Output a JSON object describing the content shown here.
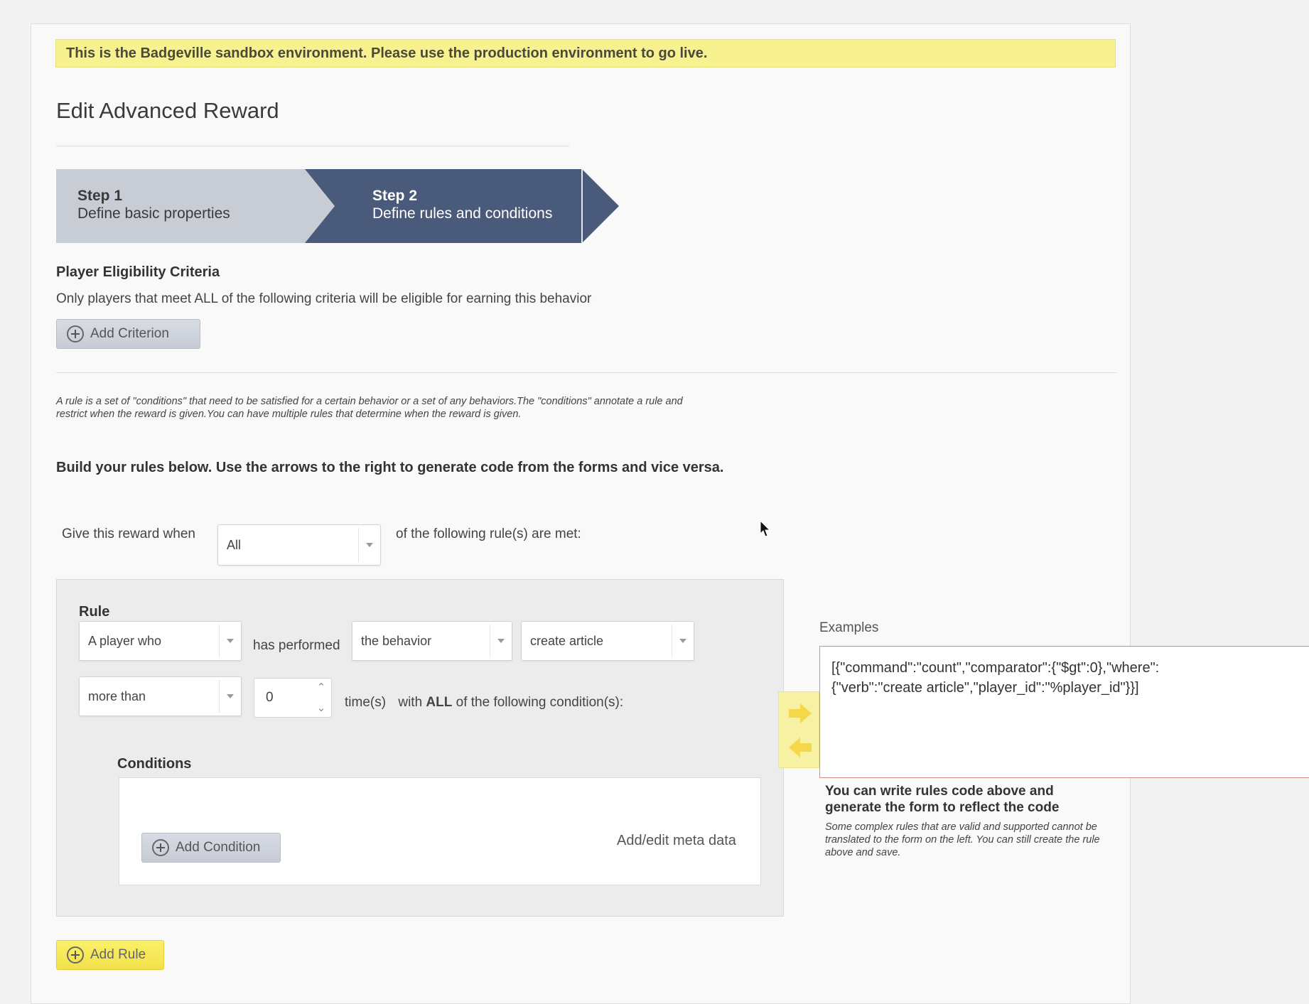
{
  "banner": "This is the Badgeville sandbox environment. Please use the production environment to go live.",
  "page_title": "Edit Advanced Reward",
  "wizard": {
    "steps": [
      {
        "number": "Step 1",
        "label": "Define basic properties"
      },
      {
        "number": "Step 2",
        "label": "Define rules and conditions"
      }
    ],
    "active_index": 1
  },
  "eligibility": {
    "heading": "Player Eligibility Criteria",
    "description": "Only players that meet ALL of the following criteria will be eligible for earning this behavior",
    "add_button": "Add Criterion"
  },
  "rules_intro": {
    "description": "A rule is a set of \"conditions\" that need to be satisfied for a certain behavior or a set of any behaviors.The \"conditions\" annotate a rule and restrict when the reward is given.You can have multiple rules that determine when the reward is given.",
    "heading": "Build your rules below. Use the arrows to the right to generate code from the forms and vice versa."
  },
  "reward_when": {
    "prefix": "Give this reward when",
    "selected": "All",
    "suffix": "of the following rule(s) are met:"
  },
  "rule": {
    "title": "Rule",
    "subject_select": "A player who",
    "verb_text": "has performed",
    "target_select": "the behavior",
    "behavior_select": "create article",
    "comparator_select": "more than",
    "count_value": "0",
    "times_text": "time(s)",
    "with_text": "with",
    "all_text": "ALL",
    "conditions_suffix": "of the following condition(s):",
    "conditions_title": "Conditions",
    "add_condition_button": "Add Condition",
    "meta_link": "Add/edit meta data"
  },
  "add_rule_button": "Add Rule",
  "examples": {
    "label": "Examples",
    "code_line1": "[{\"command\":\"count\",\"comparator\":{\"$gt\":0},\"where\":",
    "code_line2": "{\"verb\":\"create article\",\"player_id\":\"%player_id\"}}]",
    "note": "You can write rules code above and generate the form to reflect the code",
    "note_italic": "Some complex rules that are valid and supported cannot be translated to the form on the left. You can still create the rule above and save."
  },
  "colors": {
    "banner_bg": "#f7f28f",
    "step_inactive": "#c8ccd4",
    "step_active": "#4a5a7a",
    "arrow_yellow": "#f5d74a",
    "code_border": "#d38b8b"
  }
}
